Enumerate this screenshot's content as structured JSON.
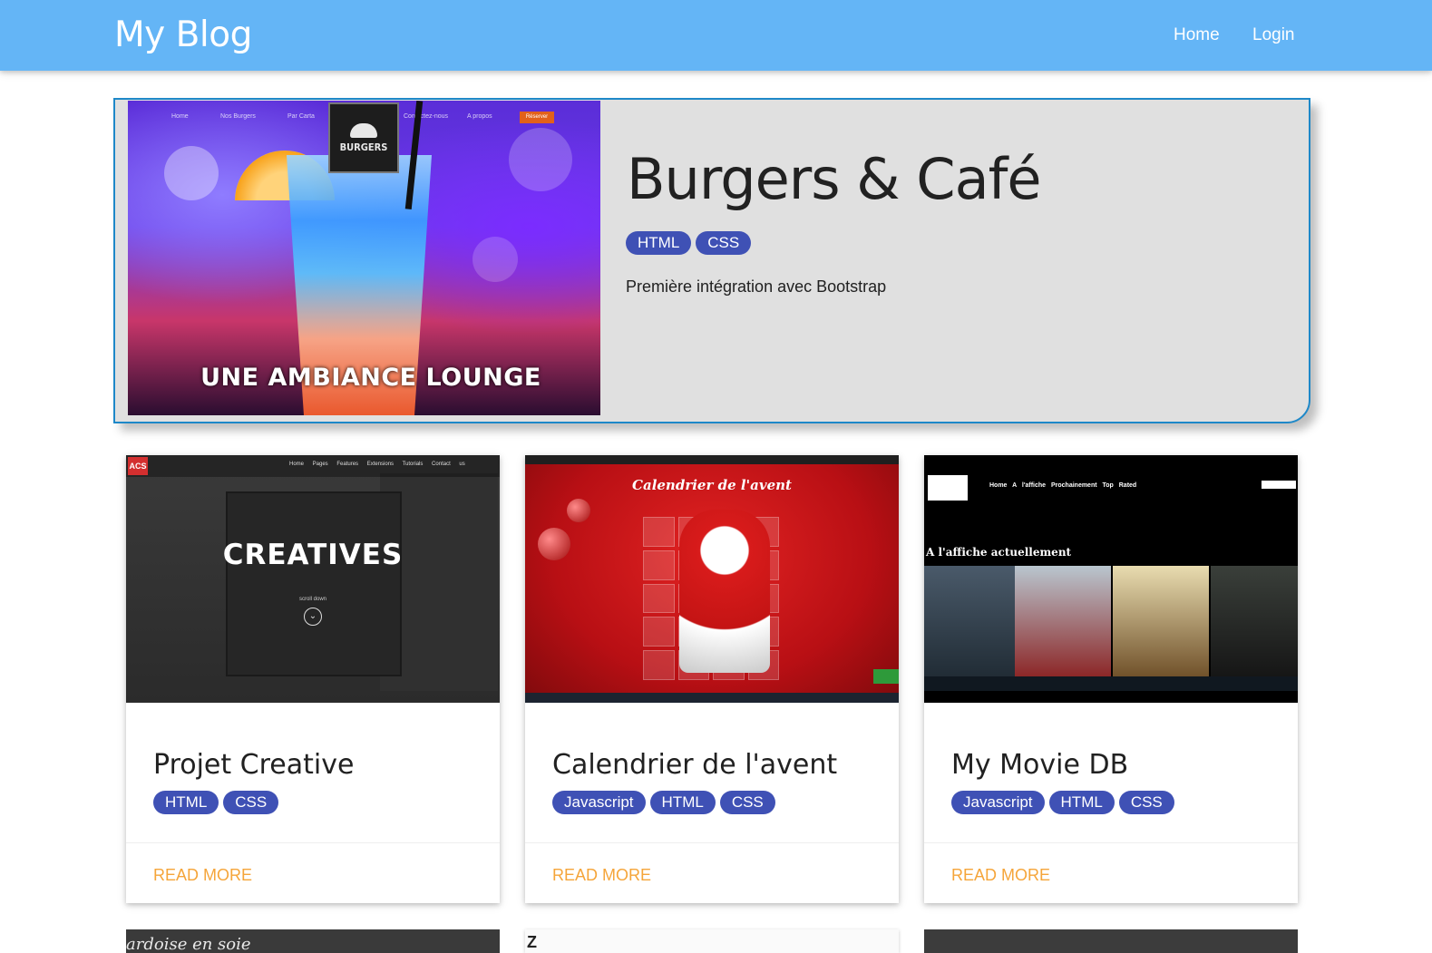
{
  "navbar": {
    "brand": "My Blog",
    "links": [
      "Home",
      "Login"
    ],
    "background_color": "#64b5f6"
  },
  "featured": {
    "title": "Burgers & Café",
    "tags": [
      "HTML",
      "CSS"
    ],
    "description": "Première intégration avec Bootstrap",
    "image": {
      "logo_text": "BURGERS",
      "mini_nav": [
        "Home",
        "Nos Burgers",
        "Par Carta",
        "Contactez-nous",
        "A propos"
      ],
      "mini_button": "Réserver",
      "overlay_text": "UNE AMBIANCE LOUNGE"
    }
  },
  "cards": [
    {
      "title": "Projet Creative",
      "tags": [
        "HTML",
        "CSS"
      ],
      "read_more": "READ MORE",
      "image": {
        "badge": "ACS",
        "nav": "Home Pages Features Extensions Tutorials Contact us",
        "headline": "CREATIVES",
        "scroll_label": "scroll down"
      }
    },
    {
      "title": "Calendrier de l'avent",
      "tags": [
        "Javascript",
        "HTML",
        "CSS"
      ],
      "read_more": "READ MORE",
      "image": {
        "headline": "Calendrier de l'avent"
      }
    },
    {
      "title": "My Movie DB",
      "tags": [
        "Javascript",
        "HTML",
        "CSS"
      ],
      "read_more": "READ MORE",
      "image": {
        "nav": "Home A l'affiche Prochainement Top Rated",
        "headline": "A l'affiche actuellement"
      }
    }
  ],
  "partial_cards": {
    "first_text": "ardoise en soie",
    "second_text": "Z"
  },
  "colors": {
    "tag_bg": "#3f51b5",
    "read_more": "#f5a53a",
    "featured_border": "#1e88c8",
    "featured_bg": "#e0e0e0"
  }
}
